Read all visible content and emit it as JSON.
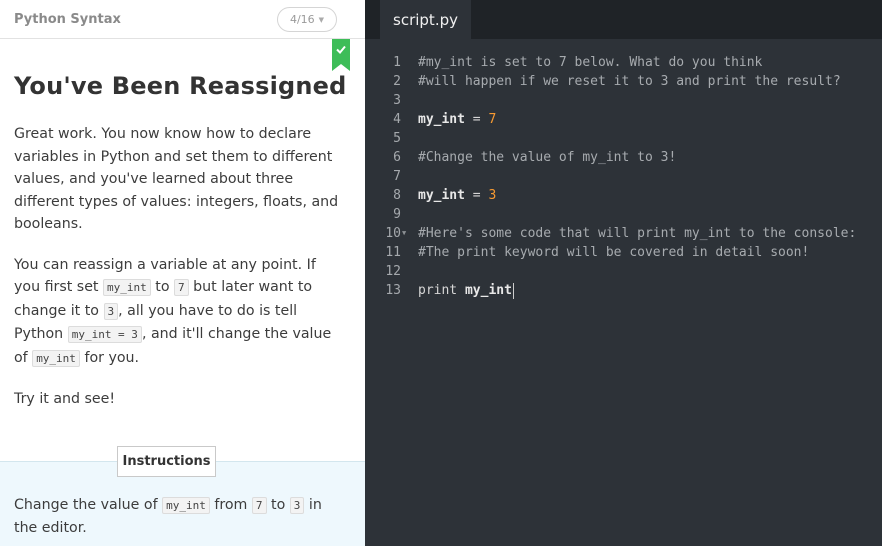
{
  "header": {
    "course_title": "Python Syntax",
    "progress": "4/16"
  },
  "lesson": {
    "title": "You've Been Reassigned",
    "p1": "Great work. You now know how to declare variables in Python and set them to different values, and you've learned about three different types of values: integers, floats, and booleans.",
    "p2": {
      "t1": "You can reassign a variable at any point. If you first set ",
      "c1": "my_int",
      "t2": " to ",
      "c2": "7",
      "t3": " but later want to change it to ",
      "c3": "3",
      "t4": ", all you have to do is tell Python ",
      "c4": "my_int = 3",
      "t5": ", and it'll change the value of ",
      "c5": "my_int",
      "t6": " for you."
    },
    "p3": "Try it and see!"
  },
  "instructions": {
    "label": "Instructions",
    "t1": "Change the value of ",
    "c1": "my_int",
    "t2": " from ",
    "c2": "7",
    "t3": " to ",
    "c3": "3",
    "t4": " in the editor."
  },
  "editor": {
    "tab": "script.py",
    "lines": {
      "l1": {
        "n": "1",
        "text": "#my_int is set to 7 below. What do you think"
      },
      "l2": {
        "n": "2",
        "text": "#will happen if we reset it to 3 and print the result?"
      },
      "l3": {
        "n": "3"
      },
      "l4": {
        "n": "4",
        "ident": "my_int",
        "op": " = ",
        "num": "7"
      },
      "l5": {
        "n": "5"
      },
      "l6": {
        "n": "6",
        "text": "#Change the value of my_int to 3!"
      },
      "l7": {
        "n": "7"
      },
      "l8": {
        "n": "8",
        "ident": "my_int",
        "op": " = ",
        "num": "3"
      },
      "l9": {
        "n": "9"
      },
      "l10": {
        "n": "10",
        "text": "#Here's some code that will print my_int to the console:"
      },
      "l11": {
        "n": "11",
        "text": "#The print keyword will be covered in detail soon!"
      },
      "l12": {
        "n": "12"
      },
      "l13": {
        "n": "13",
        "kw": "print ",
        "ident": "my_int"
      }
    }
  },
  "icons": {
    "bookmark": "check-bookmark-icon",
    "fold": "fold-arrow-icon",
    "dropdown": "chevron-down-icon"
  },
  "colors": {
    "accent": "#3dbd58",
    "editor_bg": "#2d3238",
    "number": "#f79a32"
  }
}
